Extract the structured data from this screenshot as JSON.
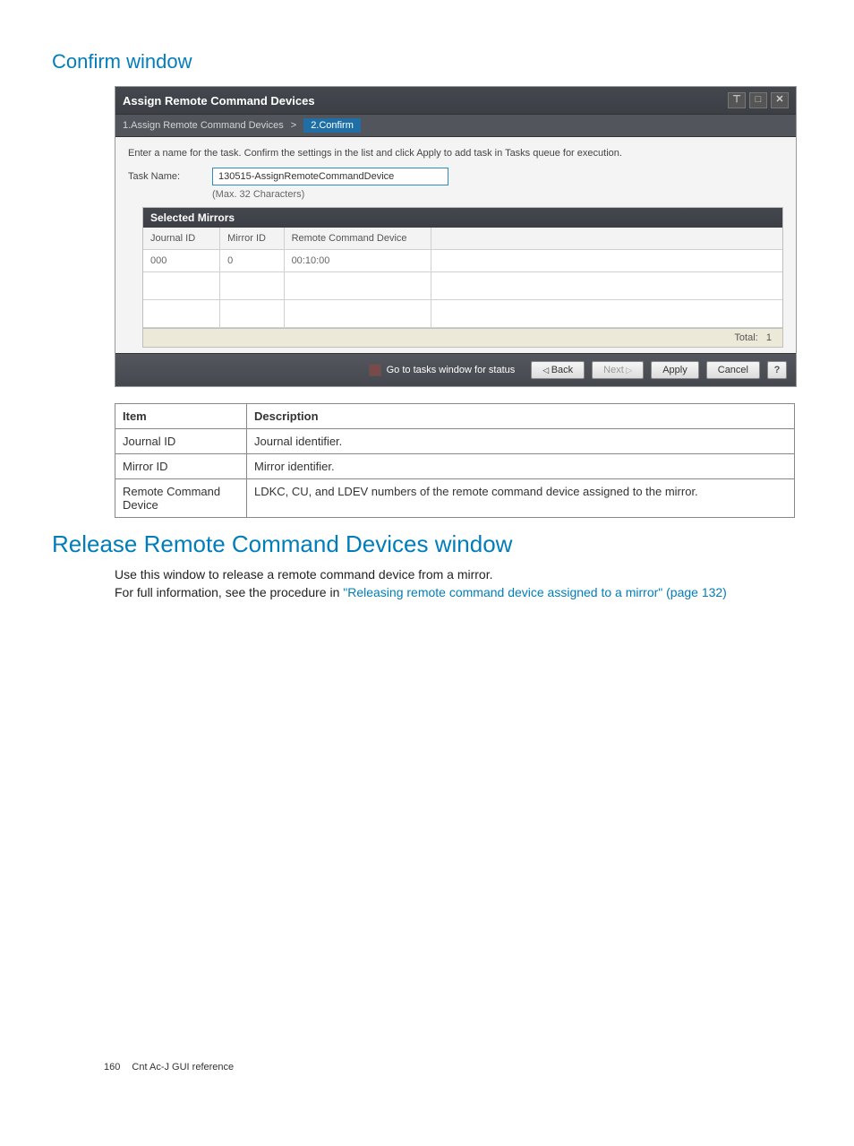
{
  "headings": {
    "confirm_window": "Confirm window",
    "release_window": "Release Remote Command Devices window"
  },
  "dialog": {
    "title": "Assign Remote Command Devices",
    "crumbs": {
      "step1": "1.Assign Remote Command Devices",
      "sep": ">",
      "step2": "2.Confirm"
    },
    "instruction": "Enter a name for the task. Confirm the settings in the list and click Apply to add task in Tasks queue for execution.",
    "task_label": "Task Name:",
    "task_value": "130515-AssignRemoteCommandDevice",
    "task_hint": "(Max. 32 Characters)",
    "mirrors": {
      "title": "Selected Mirrors",
      "headers": {
        "journal_id": "Journal ID",
        "mirror_id": "Mirror ID",
        "remote_cmd": "Remote Command Device"
      },
      "rows": [
        {
          "journal_id": "000",
          "mirror_id": "0",
          "remote_cmd": "00:10:00"
        }
      ],
      "total_label": "Total:",
      "total_value": "1"
    },
    "footer": {
      "status_label": "Go to tasks window for status",
      "back": "Back",
      "next": "Next",
      "apply": "Apply",
      "cancel": "Cancel",
      "help": "?"
    }
  },
  "desc_table": {
    "headers": {
      "item": "Item",
      "description": "Description"
    },
    "rows": [
      {
        "item": "Journal ID",
        "desc": "Journal identifier."
      },
      {
        "item": "Mirror ID",
        "desc": "Mirror identifier."
      },
      {
        "item": "Remote Command Device",
        "desc": "LDKC, CU, and LDEV numbers of the remote command device assigned to the mirror."
      }
    ]
  },
  "release_section": {
    "p1": "Use this window to release a remote command device from a mirror.",
    "p2_pre": "For full information, see the procedure in ",
    "p2_link": "\"Releasing remote command device assigned to a mirror\" (page 132)"
  },
  "page_footer": {
    "num": "160",
    "text": "Cnt Ac-J GUI reference"
  }
}
